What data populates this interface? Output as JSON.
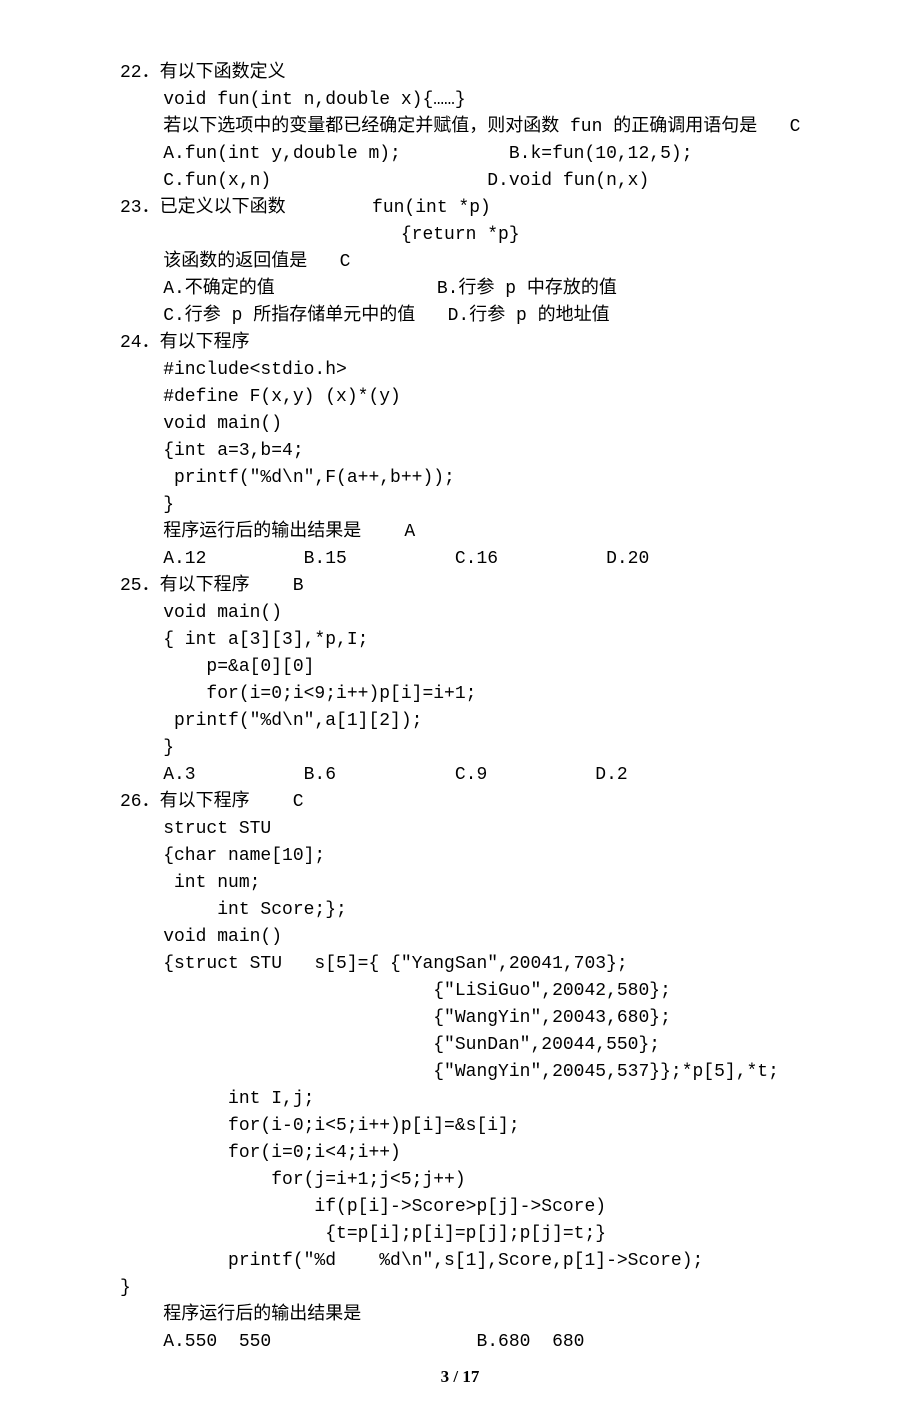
{
  "lines": [
    "22．有以下函数定义",
    "    void fun(int n,double x){……}",
    "    若以下选项中的变量都已经确定并赋值，则对函数 fun 的正确调用语句是   C",
    "    A.fun(int y,double m);          B.k=fun(10,12,5);",
    "    C.fun(x,n)                    D.void fun(n,x)",
    "23．已定义以下函数        fun(int *p)",
    "                          {return *p}",
    "    该函数的返回值是   C",
    "    A.不确定的值               B.行参 p 中存放的值",
    "    C.行参 p 所指存储单元中的值   D.行参 p 的地址值",
    "24．有以下程序",
    "    #include<stdio.h>",
    "    #define F(x,y) (x)*(y)",
    "    void main()",
    "    {int a=3,b=4;",
    "     printf(\"%d\\n\",F(a++,b++));",
    "    }",
    "    程序运行后的输出结果是    A",
    "    A.12         B.15          C.16          D.20",
    "25．有以下程序    B",
    "    void main()",
    "    { int a[3][3],*p,I;",
    "        p=&a[0][0]",
    "        for(i=0;i<9;i++)p[i]=i+1;",
    "     printf(\"%d\\n\",a[1][2]);",
    "    }",
    "    A.3          B.6           C.9          D.2",
    "26．有以下程序    C",
    "    struct STU",
    "    {char name[10];",
    "     int num;",
    "         int Score;};",
    "    void main()",
    "    {struct STU   s[5]={ {\"YangSan\",20041,703};",
    "                             {\"LiSiGuo\",20042,580};",
    "                             {\"WangYin\",20043,680};",
    "                             {\"SunDan\",20044,550};",
    "                             {\"WangYin\",20045,537}};*p[5],*t;",
    "          int I,j;",
    "          for(i-0;i<5;i++)p[i]=&s[i];",
    "          for(i=0;i<4;i++)",
    "              for(j=i+1;j<5;j++)",
    "                  if(p[i]->Score>p[j]->Score)",
    "                   {t=p[i];p[i]=p[j];p[j]=t;}",
    "          printf(\"%d    %d\\n\",s[1],Score,p[1]->Score);",
    "}",
    "    程序运行后的输出结果是",
    "    A.550  550                   B.680  680"
  ],
  "footer": "3 / 17"
}
